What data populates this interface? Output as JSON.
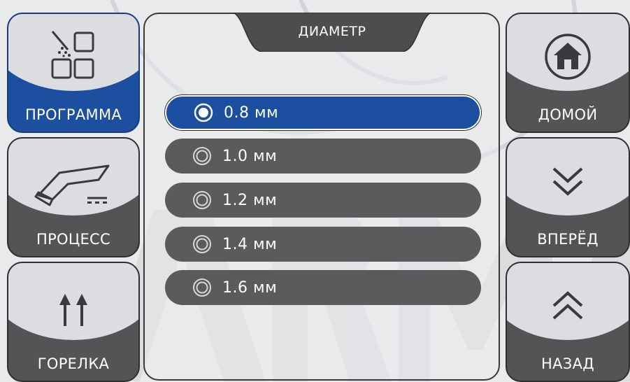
{
  "left_menu": [
    {
      "label": "ПРОГРАММА",
      "icon": "program-icon",
      "active": true
    },
    {
      "label": "ПРОЦЕСС",
      "icon": "torch-process-icon",
      "active": false
    },
    {
      "label": "ГОРЕЛКА",
      "icon": "double-arrow-up-icon",
      "active": false
    }
  ],
  "right_menu": [
    {
      "label": "ДОМОЙ",
      "icon": "home-icon"
    },
    {
      "label": "ВПЕРЁД",
      "icon": "chevron-double-down-icon"
    },
    {
      "label": "НАЗАД",
      "icon": "chevron-double-up-icon"
    }
  ],
  "panel": {
    "title": "ДИАМЕТР",
    "options": [
      {
        "value": "0.8 мм",
        "selected": true
      },
      {
        "value": "1.0 мм",
        "selected": false
      },
      {
        "value": "1.2 мм",
        "selected": false
      },
      {
        "value": "1.4 мм",
        "selected": false
      },
      {
        "value": "1.6 мм",
        "selected": false
      }
    ]
  },
  "colors": {
    "accent": "#1c4fa0",
    "button_dark": "#545457",
    "button_light": "#dcdde0",
    "background": "#e9eaec"
  },
  "watermark": "ARMA"
}
